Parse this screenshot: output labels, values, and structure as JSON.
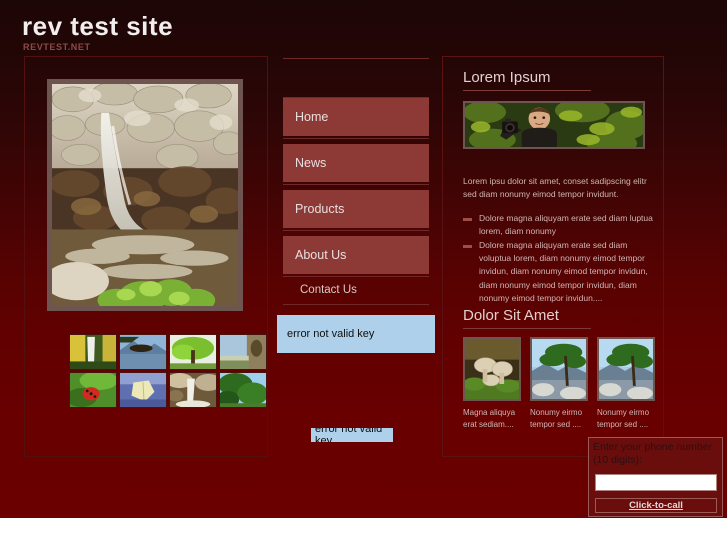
{
  "header": {
    "title": "rev test site",
    "subtitle": "REVTEST.NET"
  },
  "colors": {
    "page_bg_top": "#1d0606",
    "page_bg_bottom": "#6a0000",
    "nav_button": "#8d3a37",
    "error_box_bg": "#aed0ea",
    "heading_text": "#e2cfcf",
    "body_text": "#cfb6b4",
    "frame_border": "#6f5550"
  },
  "left_panel": {
    "hero_image_alt": "waterfall-over-rocks",
    "thumbnails": [
      {
        "alt": "autumn-waterfall-thumb"
      },
      {
        "alt": "mountain-lake-thumb"
      },
      {
        "alt": "green-tree-thumb"
      },
      {
        "alt": "tree-trunk-thumb"
      },
      {
        "alt": "ladybug-leaf-thumb"
      },
      {
        "alt": "yellow-leaf-water-thumb"
      },
      {
        "alt": "rocky-waterfall-thumb"
      },
      {
        "alt": "pine-tree-sky-thumb"
      }
    ]
  },
  "nav": {
    "items": [
      {
        "label": "Home",
        "style": "button"
      },
      {
        "label": "News",
        "style": "button"
      },
      {
        "label": "Products",
        "style": "button"
      },
      {
        "label": "About Us",
        "style": "button"
      },
      {
        "label": "Contact Us",
        "style": "plain"
      }
    ],
    "error_box_1": "error not valid key",
    "error_box_2": "error not valid key"
  },
  "right_panel": {
    "section_1": {
      "heading": "Lorem Ipsum",
      "feature_image_alt": "man-with-camera-in-foliage",
      "intro": "Lorem ipsu dolor sit amet, conset sadipscing elitr sed diam nonumy eimod tempor invidunt.",
      "bullets": [
        "Dolore magna aliquyam erate sed diam luptua lorem, diam nonumy",
        "Dolore magna aliquyam erate sed diam voluptua lorem, diam nonumy eimod tempor invidun, diam nonumy eimod tempor invidun, diam nonumy eimod tempor invidun, diam nonumy eimod tempor invidun...."
      ]
    },
    "section_2": {
      "heading": "Dolor Sit Amet",
      "items": [
        {
          "image_alt": "mushrooms-on-moss",
          "caption": "Magna aliquya erat sediam...."
        },
        {
          "image_alt": "pine-tree-on-mountain-ridge",
          "caption": "Nonumy eirmo tempor sed ...."
        },
        {
          "image_alt": "pine-tree-on-mountain-ridge-2",
          "caption": "Nonumy eirmo tempor sed ...."
        }
      ]
    }
  },
  "click_to_call": {
    "label": "Enter your phone number (10 digits):",
    "input_value": "",
    "input_placeholder": "",
    "button_label": "Click-to-call"
  }
}
